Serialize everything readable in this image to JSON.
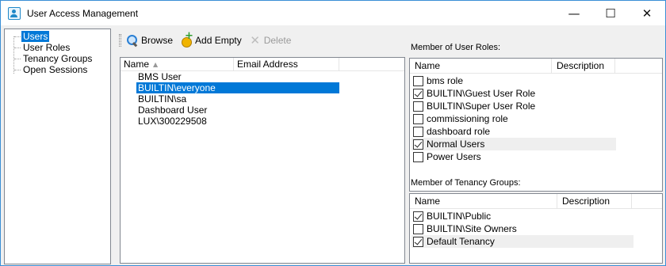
{
  "window": {
    "title": "User Access Management",
    "icon": "user-access-icon",
    "controls": {
      "minimize": "—",
      "maximize": "☐",
      "close": "✕"
    }
  },
  "tree": {
    "items": [
      {
        "label": "Users",
        "selected": true
      },
      {
        "label": "User Roles",
        "selected": false
      },
      {
        "label": "Tenancy Groups",
        "selected": false
      },
      {
        "label": "Open Sessions",
        "selected": false
      }
    ]
  },
  "toolbar": {
    "browse_label": "Browse",
    "add_empty_label": "Add Empty",
    "delete_label": "Delete"
  },
  "users_list": {
    "columns": [
      "Name",
      "Email Address"
    ],
    "rows": [
      {
        "name": "BMS User",
        "email": "",
        "selected": false
      },
      {
        "name": "BUILTIN\\everyone",
        "email": "",
        "selected": true
      },
      {
        "name": "BUILTIN\\sa",
        "email": "",
        "selected": false
      },
      {
        "name": "Dashboard User",
        "email": "",
        "selected": false
      },
      {
        "name": "LUX\\300229508",
        "email": "",
        "selected": false
      }
    ]
  },
  "user_roles": {
    "label": "Member of User Roles:",
    "columns": [
      "Name",
      "Description"
    ],
    "rows": [
      {
        "name": "bms role",
        "checked": false
      },
      {
        "name": "BUILTIN\\Guest User Role",
        "checked": true
      },
      {
        "name": "BUILTIN\\Super User Role",
        "checked": false
      },
      {
        "name": "commissioning role",
        "checked": false
      },
      {
        "name": "dashboard role",
        "checked": false
      },
      {
        "name": "Normal Users",
        "checked": true,
        "highlighted": true
      },
      {
        "name": "Power Users",
        "checked": false
      }
    ]
  },
  "tenancy_groups": {
    "label": "Member of Tenancy Groups:",
    "columns": [
      "Name",
      "Description"
    ],
    "rows": [
      {
        "name": "BUILTIN\\Public",
        "checked": true
      },
      {
        "name": "BUILTIN\\Site Owners",
        "checked": false
      },
      {
        "name": "Default Tenancy",
        "checked": true,
        "highlighted": true
      }
    ]
  },
  "colors": {
    "selection": "#0078d7",
    "window_border": "#3a8fd6"
  }
}
